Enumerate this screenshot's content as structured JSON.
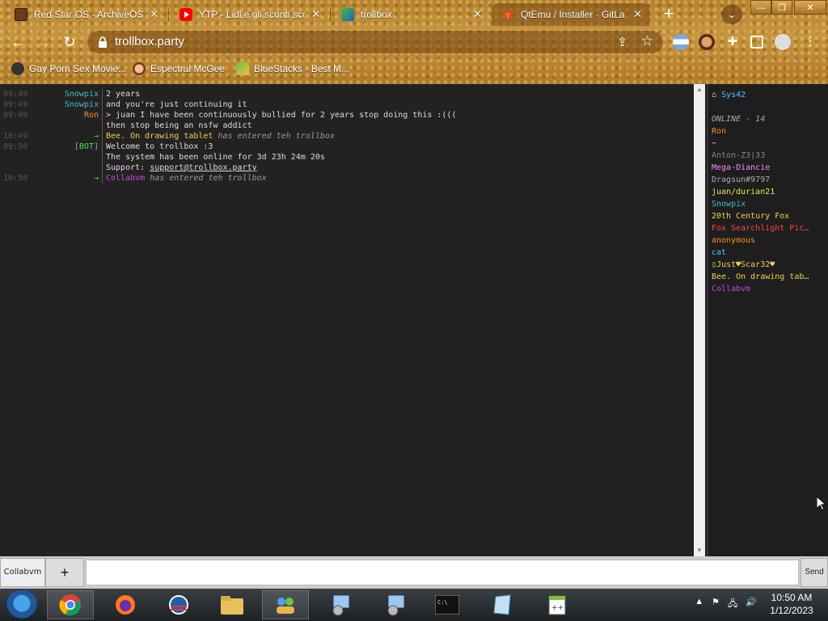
{
  "browser": {
    "tabs": [
      {
        "title": "Red Star OS - ArchiveOS",
        "icon": "red-star-os-icon"
      },
      {
        "title": "YTP - Lidl e gli sconti scon",
        "icon": "youtube-icon"
      },
      {
        "title": "trollbox",
        "icon": "trollbox-icon"
      },
      {
        "title": "QtEmu / Installer · GitLa",
        "icon": "gitlab-icon"
      }
    ],
    "active_tab": 3,
    "url": "trollbox.party",
    "bookmarks": [
      {
        "label": "Gay Porn Sex Movie...",
        "icon": "site-icon"
      },
      {
        "label": "Espectral McGee",
        "icon": "face-icon"
      },
      {
        "label": "BlueStacks - Best M...",
        "icon": "bluestacks-icon"
      }
    ]
  },
  "chat": {
    "messages": [
      {
        "time": "09:49",
        "nick": "Snowpix",
        "nick_color": "#3fbfbf",
        "text": "2 years"
      },
      {
        "time": "09:49",
        "nick": "Snowpix",
        "nick_color": "#3fbfbf",
        "text": "and you're just continuing it"
      },
      {
        "time": "09:49",
        "nick": "Ron",
        "nick_color": "#ff8c1a",
        "text": "> juan I have been continuously bullied for 2 years stop doing this :((("
      },
      {
        "time": "",
        "nick": "",
        "nick_color": "#ff8c1a",
        "text": "then stop being an nsfw addict"
      },
      {
        "time": "10:49",
        "nick": "→",
        "nick_color": "#55dd55",
        "text_name": "Bee. On drawing tablet",
        "name_color": "#f0d050",
        "text_tail": " has entered teh trollbox"
      },
      {
        "time": "09:50",
        "nick": "[BOT]",
        "nick_color": "#55dd55",
        "text": "Welcome to trollbox :3"
      },
      {
        "time": "",
        "nick": "",
        "nick_color": "#55dd55",
        "text": "The system has been online for 3d 23h 24m 20s"
      },
      {
        "time": "",
        "nick": "",
        "nick_color": "#55dd55",
        "text_prefix": "Support: ",
        "link": "support@trollbox.party"
      },
      {
        "time": "10:50",
        "nick": "→",
        "nick_color": "#55dd55",
        "text_name": "Collabvm",
        "name_color": "#cc44dd",
        "text_tail": " has entered teh trollbox"
      }
    ]
  },
  "userlist": {
    "me": "Sys42",
    "online_label": "ONLINE - 14",
    "users": [
      {
        "name": "Ron",
        "color": "#ff8c1a"
      },
      {
        "name": "~",
        "color": "#dddddd"
      },
      {
        "name": "Anton-Z3|33",
        "color": "#888888"
      },
      {
        "name": "Mega-Diancie",
        "color": "#ff88ff"
      },
      {
        "name": "Dragsun#9797",
        "color": "#aaaaaa"
      },
      {
        "name": "juan/durian21",
        "color": "#ddee55"
      },
      {
        "name": "Snowpix",
        "color": "#3fbfbf"
      },
      {
        "name": "20th Century Fox",
        "color": "#f0d050"
      },
      {
        "name": "Fox Searchlight Pic…",
        "color": "#ff4444"
      },
      {
        "name": "anonymous",
        "color": "#ff8c1a"
      },
      {
        "name": "cat",
        "color": "#4fc3f7"
      },
      {
        "name": "▯Just♥Scar32♥",
        "color": "#f0d050"
      },
      {
        "name": "Bee. On drawing tab…",
        "color": "#f0d050"
      },
      {
        "name": "Collabvm",
        "color": "#cc44dd"
      }
    ]
  },
  "input": {
    "room_label": "Collabvm",
    "add_label": "+",
    "send_label": "Send",
    "value": ""
  },
  "taskbar": {
    "time": "10:50 AM",
    "date": "1/12/2023"
  }
}
